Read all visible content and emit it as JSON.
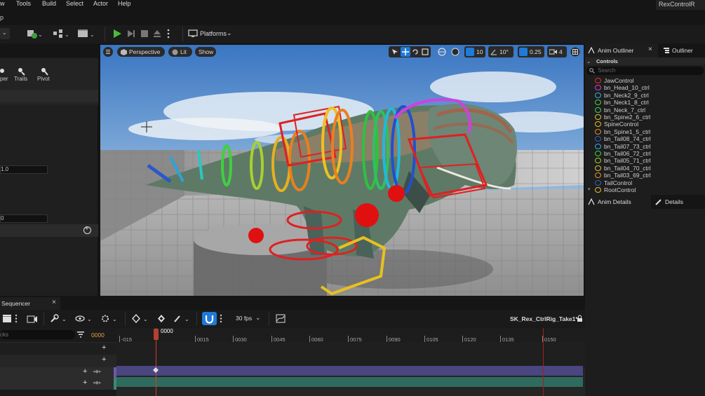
{
  "menu": [
    "w",
    "Tools",
    "Build",
    "Select",
    "Actor",
    "Help"
  ],
  "window_tab": "RexControlR",
  "tab_fragment": "p",
  "toolbar": {
    "platforms_label": "Platforms"
  },
  "left_panel": {
    "tools": [
      "per",
      "Trails",
      "Pivot"
    ],
    "field1": "1.0",
    "field2": "0"
  },
  "viewport": {
    "perspective_label": "Perspective",
    "lit_label": "Lit",
    "show_label": "Show",
    "grid_snap": "10",
    "rot_snap": "10°",
    "scale_snap": "0.25",
    "camera_speed": "4"
  },
  "outliner": {
    "tab_anim_outliner": "Anim Outliner",
    "tab_outliner": "Outliner",
    "section_label": "Controls",
    "search_placeholder": "Search",
    "items": [
      {
        "label": "JawControl",
        "color": "#e03030"
      },
      {
        "label": "bn_Head_10_ctrl",
        "color": "#d040d0"
      },
      {
        "label": "bn_Neck2_9_ctrl",
        "color": "#30b0e0"
      },
      {
        "label": "bn_Neck1_8_ctrl",
        "color": "#40d040"
      },
      {
        "label": "bn_Neck_7_ctrl",
        "color": "#40d060"
      },
      {
        "label": "bn_Spine2_6_ctrl",
        "color": "#e0c030"
      },
      {
        "label": "SpineControl",
        "color": "#e8c020"
      },
      {
        "label": "bn_Spine1_5_ctrl",
        "color": "#e09030"
      },
      {
        "label": "bn_Tail08_74_ctrl",
        "color": "#3060d0"
      },
      {
        "label": "bn_Tail07_73_ctrl",
        "color": "#30b0e0"
      },
      {
        "label": "bn_Tail06_72_ctrl",
        "color": "#40d040"
      },
      {
        "label": "bn_Tail05_71_ctrl",
        "color": "#a0d030"
      },
      {
        "label": "bn_Tail04_70_ctrl",
        "color": "#e0c030"
      },
      {
        "label": "bn_Tail03_69_ctrl",
        "color": "#e09030"
      },
      {
        "label": "TailControl",
        "color": "#3060d0"
      },
      {
        "label": "RootControl",
        "color": "#e8c020"
      }
    ],
    "tab_anim_details": "Anim Details",
    "tab_details": "Details"
  },
  "sequencer": {
    "tab_label": "Sequencer",
    "fps_label": "30 fps",
    "sequence_name": "SK_Rex_CtrlRig_Take1*",
    "search_fragment": "cks",
    "current_frame": "0000",
    "playhead_label": "0000",
    "ticks": [
      "-015",
      "0015",
      "0030",
      "0045",
      "0060",
      "0075",
      "0090",
      "0105",
      "0120",
      "0135",
      "0150"
    ]
  }
}
